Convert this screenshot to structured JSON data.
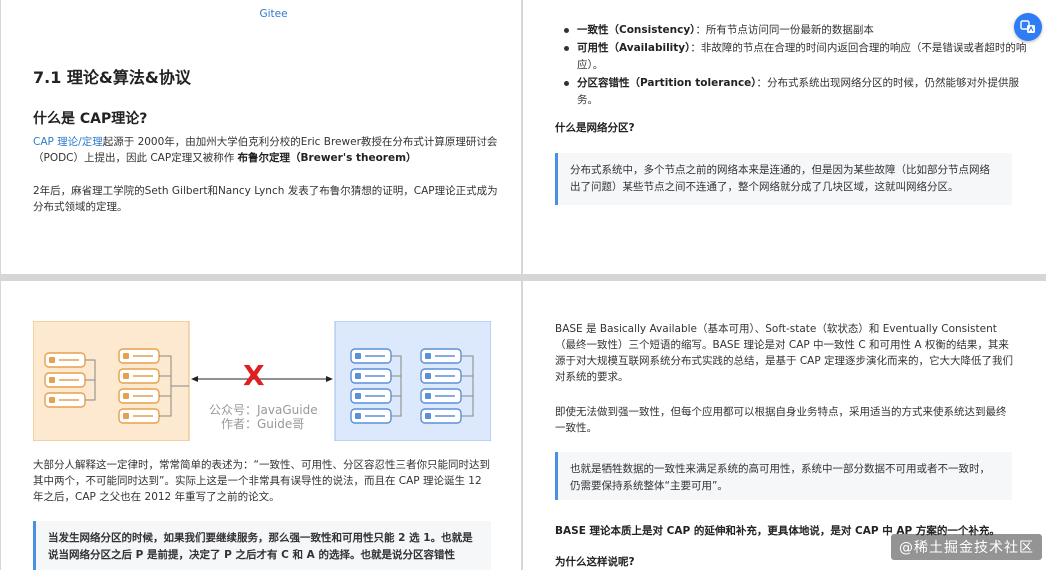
{
  "p1": {
    "top_link": "Gitee",
    "section_title": "7.1 理论&算法&协议",
    "sub_title": "什么是 CAP理论?",
    "para1_link": "CAP 理论/定理",
    "para1_text": "起源于 2000年，由加州大学伯克利分校的Eric Brewer教授在分布式计算原理研讨会（PODC）上提出，因此 CAP定理又被称作 ",
    "para1_bold": "布鲁尔定理（Brewer's theorem）",
    "para2": "2年后，麻省理工学院的Seth Gilbert和Nancy Lynch 发表了布鲁尔猜想的证明，CAP理论正式成为分布式领域的定理。"
  },
  "p2": {
    "bullets": [
      {
        "bold": "一致性（Consistency）",
        "text": "：所有节点访问同一份最新的数据副本"
      },
      {
        "bold": "可用性（Availability）",
        "text": "：非故障的节点在合理的时间内返回合理的响应（不是错误或者超时的响应）。"
      },
      {
        "bold": "分区容错性（Partition tolerance）",
        "text": "：分布式系统出现网络分区的时候，仍然能够对外提供服务。"
      }
    ],
    "question": "什么是网络分区?",
    "quote": "分布式系统中，多个节点之前的网络本来是连通的，但是因为某些故障（比如部分节点网络出了问题）某些节点之间不连通了，整个网络就分成了几块区域，这就叫网络分区。"
  },
  "p3": {
    "diagram": {
      "cross": "X",
      "watermark_line1": "公众号：JavaGuide",
      "watermark_line2": "作者：Guide哥",
      "left_color": "#fde9cf",
      "right_color": "#dce8fb"
    },
    "para": "大部分人解释这一定律时，常常简单的表述为：“一致性、可用性、分区容忍性三者你只能同时达到其中两个，不可能同时达到”。实际上这是一个非常具有误导性的说法，而且在 CAP 理论诞生 12 年之后，CAP 之父也在 2012 年重写了之前的论文。",
    "quote": "当发生网络分区的时候，如果我们要继续服务，那么强一致性和可用性只能 2 选 1。也就是说当网络分区之后 P 是前提，决定了 P 之后才有 C 和 A 的选择。也就是说分区容错性"
  },
  "p4": {
    "base_para": "BASE 是 Basically Available（基本可用）、Soft-state（软状态）和 Eventually Consistent（最终一致性）三个短语的缩写。BASE 理论是对 CAP 中一致性 C 和可用性 A 权衡的结果，其来源于对大规模互联网系统分布式实践的总结，是基于 CAP 定理逐步演化而来的，它大大降低了我们对系统的要求。",
    "para2": "即使无法做到强一致性，但每个应用都可以根据自身业务特点，采用适当的方式来使系统达到最终一致性。",
    "quote": "也就是牺牲数据的一致性来满足系统的高可用性，系统中一部分数据不可用或者不一致时，仍需要保持系统整体“主要可用”。",
    "para3": "BASE 理论本质上是对 CAP 的延伸和补充，更具体地说，是对 CAP 中 AP 方案的一个补充。",
    "question": "为什么这样说呢?"
  },
  "watermark": "@稀土掘金技术社区"
}
